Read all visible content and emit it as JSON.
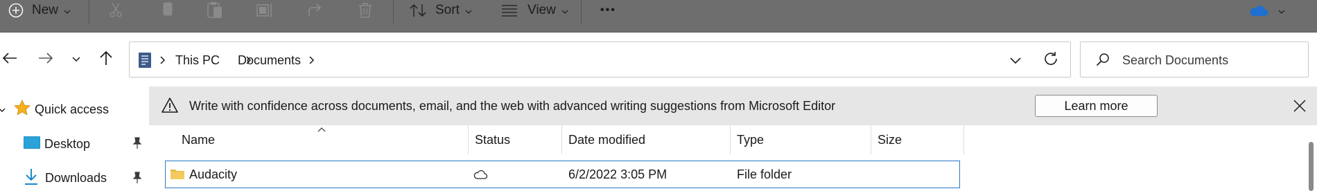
{
  "toolbar": {
    "new_label": "New",
    "sort_label": "Sort",
    "view_label": "View",
    "more_label": "•••"
  },
  "address": {
    "crumbs": [
      "This PC",
      "Documents"
    ]
  },
  "search": {
    "placeholder": "Search Documents"
  },
  "sidebar": {
    "items": [
      {
        "label": "Quick access",
        "icon": "star-icon"
      },
      {
        "label": "Desktop",
        "icon": "desktop-icon"
      },
      {
        "label": "Downloads",
        "icon": "download-icon"
      }
    ]
  },
  "infobar": {
    "message": "Write with confidence across documents, email, and the web with advanced writing suggestions from Microsoft Editor",
    "button_label": "Learn more"
  },
  "columns": {
    "name": "Name",
    "status": "Status",
    "date_modified": "Date modified",
    "type": "Type",
    "size": "Size"
  },
  "files": [
    {
      "name": "Audacity",
      "status": "cloud-icon",
      "date_modified": "6/2/2022 3:05 PM",
      "type": "File folder",
      "size": ""
    }
  ],
  "colors": {
    "toolbar_bg": "#6e6e6e",
    "accent": "#2a78c7",
    "infobar_bg": "#e6e6e6",
    "star": "#f2b01e",
    "folder": "#e8b94a"
  }
}
